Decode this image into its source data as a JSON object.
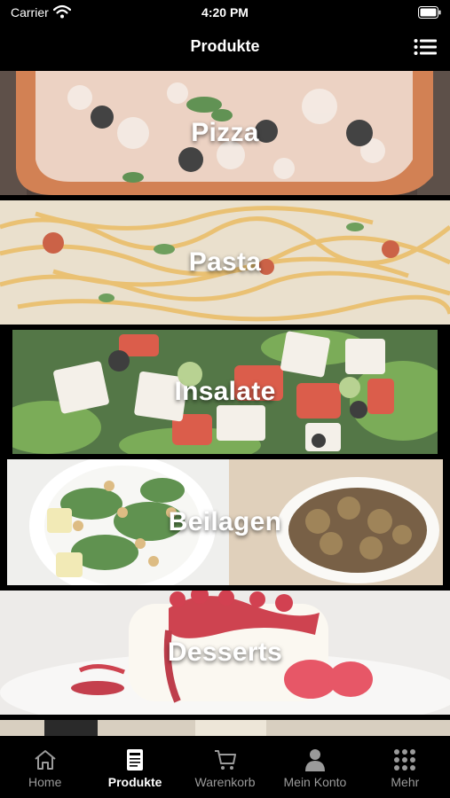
{
  "status_bar": {
    "carrier": "Carrier",
    "time": "4:20 PM"
  },
  "nav": {
    "title": "Produkte",
    "menu_icon": "list-icon"
  },
  "categories": [
    {
      "label": "Pizza"
    },
    {
      "label": "Pasta"
    },
    {
      "label": "Insalate"
    },
    {
      "label": "Beilagen"
    },
    {
      "label": "Desserts"
    }
  ],
  "tabs": [
    {
      "label": "Home",
      "icon": "home-icon"
    },
    {
      "label": "Produkte",
      "icon": "menu-card-icon",
      "active": true
    },
    {
      "label": "Warenkorb",
      "icon": "cart-icon"
    },
    {
      "label": "Mein Konto",
      "icon": "person-icon"
    },
    {
      "label": "Mehr",
      "icon": "grid-icon"
    }
  ],
  "colors": {
    "background": "#000000",
    "tab_active": "#ffffff",
    "tab_inactive": "#9a9a9a"
  }
}
